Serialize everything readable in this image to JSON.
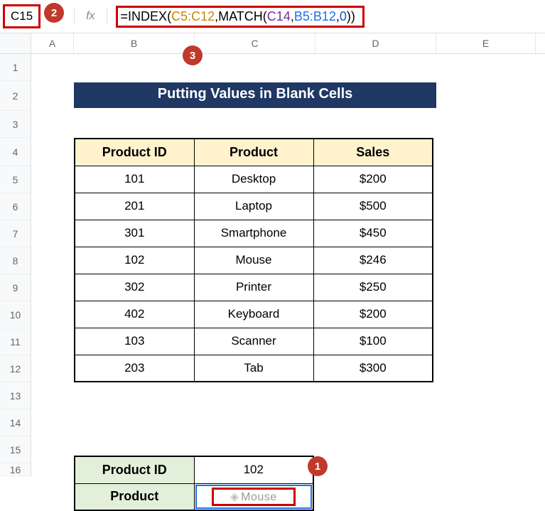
{
  "nameBox": "C15",
  "fxLabel": "fx",
  "formula": {
    "fn1": "INDEX",
    "arg1": "C5:C12",
    "fn2": "MATCH",
    "arg2a": "C14",
    "arg2b": "B5:B12",
    "arg2c": "0"
  },
  "callouts": {
    "c1": "1",
    "c2": "2",
    "c3": "3"
  },
  "columns": [
    "A",
    "B",
    "C",
    "D",
    "E"
  ],
  "rowNumbers": [
    "1",
    "2",
    "3",
    "4",
    "5",
    "6",
    "7",
    "8",
    "9",
    "10",
    "11",
    "12",
    "13",
    "14",
    "15",
    "16"
  ],
  "title": "Putting Values in Blank Cells",
  "table": {
    "headers": [
      "Product ID",
      "Product",
      "Sales"
    ],
    "rows": [
      [
        "101",
        "Desktop",
        "$200"
      ],
      [
        "201",
        "Laptop",
        "$500"
      ],
      [
        "301",
        "Smartphone",
        "$450"
      ],
      [
        "102",
        "Mouse",
        "$246"
      ],
      [
        "302",
        "Printer",
        "$250"
      ],
      [
        "402",
        "Keyboard",
        "$200"
      ],
      [
        "103",
        "Scanner",
        "$100"
      ],
      [
        "203",
        "Tab",
        "$300"
      ]
    ]
  },
  "lookup": {
    "row1Label": "Product ID",
    "row1Value": "102",
    "row2Label": "Product",
    "row2Value": "Mouse"
  }
}
